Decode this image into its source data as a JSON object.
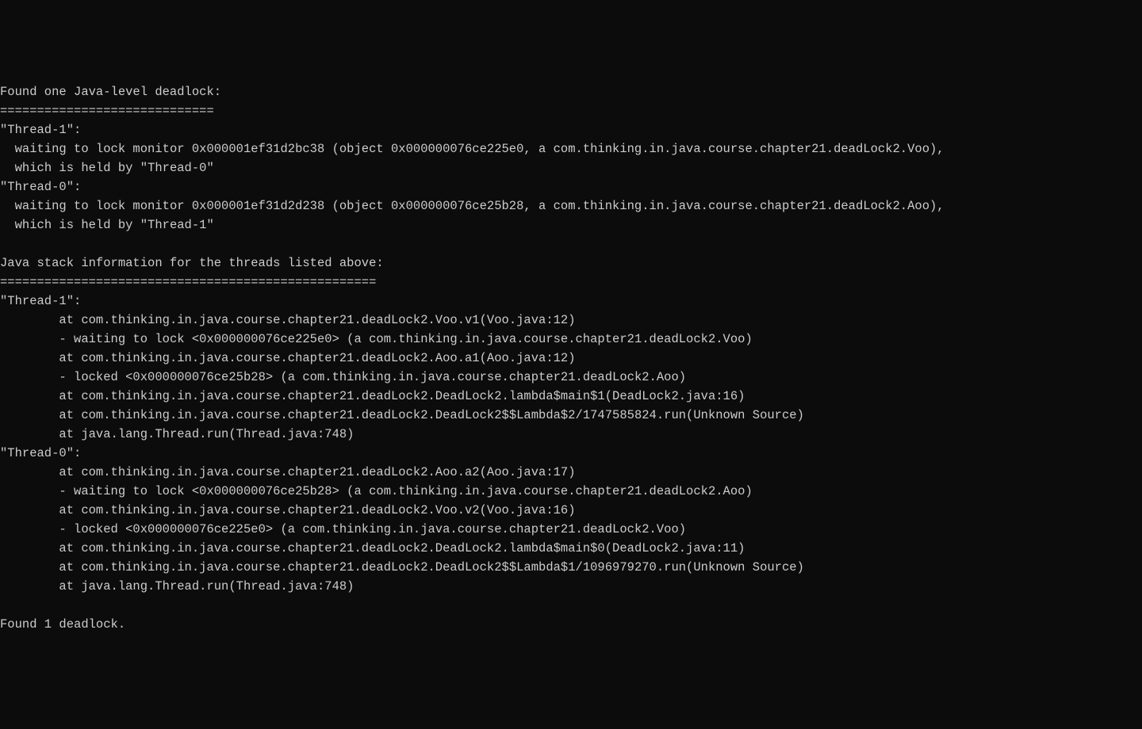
{
  "terminal": {
    "lines": [
      "Found one Java-level deadlock:",
      "=============================",
      "\"Thread-1\":",
      "  waiting to lock monitor 0x000001ef31d2bc38 (object 0x000000076ce225e0, a com.thinking.in.java.course.chapter21.deadLock2.Voo),",
      "  which is held by \"Thread-0\"",
      "\"Thread-0\":",
      "  waiting to lock monitor 0x000001ef31d2d238 (object 0x000000076ce25b28, a com.thinking.in.java.course.chapter21.deadLock2.Aoo),",
      "  which is held by \"Thread-1\"",
      "",
      "Java stack information for the threads listed above:",
      "===================================================",
      "\"Thread-1\":",
      "        at com.thinking.in.java.course.chapter21.deadLock2.Voo.v1(Voo.java:12)",
      "        - waiting to lock <0x000000076ce225e0> (a com.thinking.in.java.course.chapter21.deadLock2.Voo)",
      "        at com.thinking.in.java.course.chapter21.deadLock2.Aoo.a1(Aoo.java:12)",
      "        - locked <0x000000076ce25b28> (a com.thinking.in.java.course.chapter21.deadLock2.Aoo)",
      "        at com.thinking.in.java.course.chapter21.deadLock2.DeadLock2.lambda$main$1(DeadLock2.java:16)",
      "        at com.thinking.in.java.course.chapter21.deadLock2.DeadLock2$$Lambda$2/1747585824.run(Unknown Source)",
      "        at java.lang.Thread.run(Thread.java:748)",
      "\"Thread-0\":",
      "        at com.thinking.in.java.course.chapter21.deadLock2.Aoo.a2(Aoo.java:17)",
      "        - waiting to lock <0x000000076ce25b28> (a com.thinking.in.java.course.chapter21.deadLock2.Aoo)",
      "        at com.thinking.in.java.course.chapter21.deadLock2.Voo.v2(Voo.java:16)",
      "        - locked <0x000000076ce225e0> (a com.thinking.in.java.course.chapter21.deadLock2.Voo)",
      "        at com.thinking.in.java.course.chapter21.deadLock2.DeadLock2.lambda$main$0(DeadLock2.java:11)",
      "        at com.thinking.in.java.course.chapter21.deadLock2.DeadLock2$$Lambda$1/1096979270.run(Unknown Source)",
      "        at java.lang.Thread.run(Thread.java:748)",
      "",
      "Found 1 deadlock.",
      ""
    ]
  }
}
